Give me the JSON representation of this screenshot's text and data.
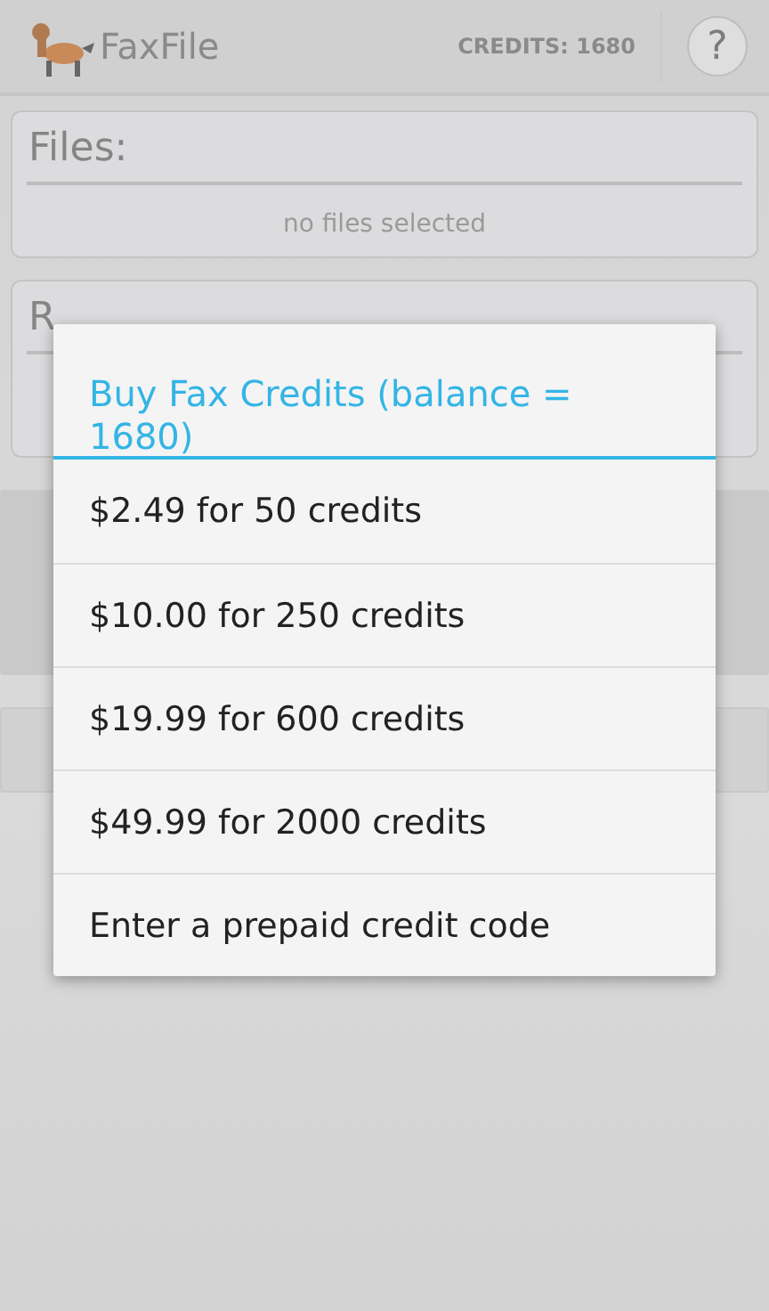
{
  "action_bar": {
    "title": "FaxFile",
    "credits": "CREDITS: 1680",
    "help": "?"
  },
  "files_card": {
    "title": "Files:",
    "empty_text": "no files selected"
  },
  "second_card": {
    "title": "R"
  },
  "dialog": {
    "title": "Buy Fax Credits (balance = 1680)",
    "options": [
      {
        "label": "$2.49 for 50 credits"
      },
      {
        "label": "$10.00 for 250 credits"
      },
      {
        "label": "$19.99 for 600 credits"
      },
      {
        "label": "$49.99 for 2000 credits"
      },
      {
        "label": "Enter a prepaid credit code"
      }
    ]
  }
}
